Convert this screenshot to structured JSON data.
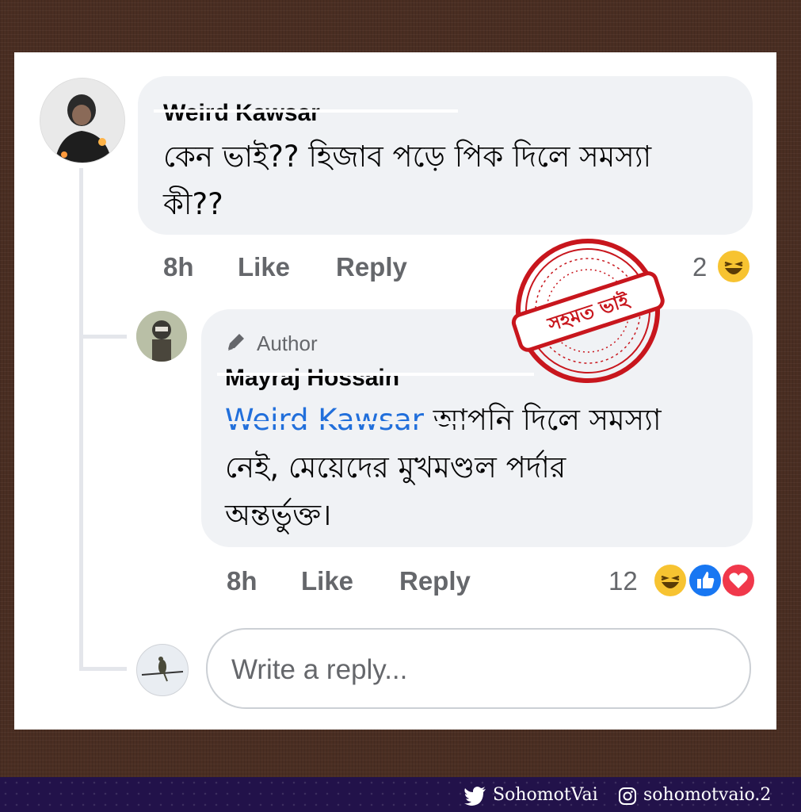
{
  "comment": {
    "author": "Weird Kawsar",
    "text_line1": "কেন ভাই?? হিজাব পড়ে পিক দিলে সমস্যা",
    "text_line2": "কী??",
    "time": "8h",
    "like_label": "Like",
    "reply_label": "Reply",
    "reaction_count": "2",
    "reactions": [
      "haha-icon"
    ]
  },
  "reply": {
    "badge": "Author",
    "author": "Mayraj Hossain",
    "mention": "Weird Kawsar",
    "text_line1_rest": " আপনি দিলে সমস্যা",
    "text_line2": "নেই, মেয়েদের মুখমণ্ডল পর্দার",
    "text_line3": "অন্তর্ভুক্ত।",
    "time": "8h",
    "like_label": "Like",
    "reply_label": "Reply",
    "reaction_count": "12",
    "reactions": [
      "haha-icon",
      "like-icon",
      "love-icon"
    ]
  },
  "composer": {
    "placeholder": "Write a reply..."
  },
  "stamp": {
    "text": "সহমত ভাই",
    "color": "#c8161d"
  },
  "footer": {
    "twitter": "SohomotVai",
    "instagram": "sohomotvaio.2"
  },
  "colors": {
    "bubble": "#f0f2f5",
    "meta": "#65676b",
    "mention": "#216fdb",
    "background": "#4a2e22",
    "footer": "#22124a"
  }
}
